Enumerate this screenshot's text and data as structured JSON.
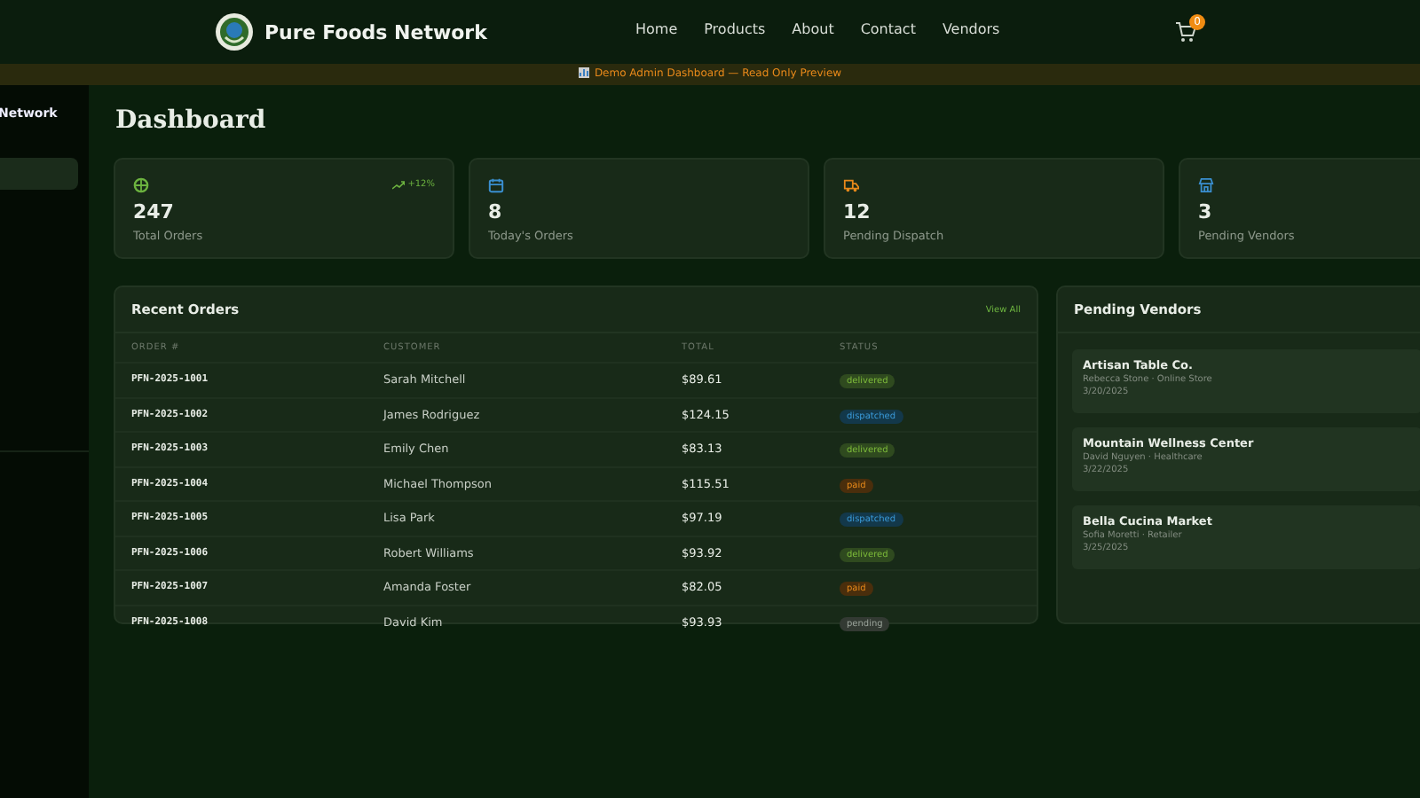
{
  "nav": {
    "brand": "Pure Foods Network",
    "links": [
      "Home",
      "Products",
      "About",
      "Contact",
      "Vendors"
    ],
    "cart_count": "0"
  },
  "banner": {
    "text": "Demo Admin Dashboard — Read Only Preview"
  },
  "sidebar": {
    "brand": "Network",
    "items": [
      {
        "selected": true
      }
    ]
  },
  "page_title": "Dashboard",
  "stats": [
    {
      "kind": "box",
      "value": "247",
      "label": "Total Orders",
      "trend": "+12%"
    },
    {
      "kind": "calendar",
      "value": "8",
      "label": "Today's Orders"
    },
    {
      "kind": "truck",
      "value": "12",
      "label": "Pending Dispatch"
    },
    {
      "kind": "store",
      "value": "3",
      "label": "Pending Vendors"
    }
  ],
  "orders": {
    "title": "Recent Orders",
    "link": "View All",
    "columns": [
      "ORDER #",
      "CUSTOMER",
      "TOTAL",
      "STATUS"
    ],
    "rows": [
      {
        "order": "PFN-2025-1001",
        "customer": "Sarah Mitchell",
        "total": "$89.61",
        "status": {
          "kind": "delivered",
          "text": "delivered"
        }
      },
      {
        "order": "PFN-2025-1002",
        "customer": "James Rodriguez",
        "total": "$124.15",
        "status": {
          "kind": "dispatched",
          "text": "dispatched"
        }
      },
      {
        "order": "PFN-2025-1003",
        "customer": "Emily Chen",
        "total": "$83.13",
        "status": {
          "kind": "delivered",
          "text": "delivered"
        }
      },
      {
        "order": "PFN-2025-1004",
        "customer": "Michael Thompson",
        "total": "$115.51",
        "status": {
          "kind": "paid",
          "text": "paid"
        }
      },
      {
        "order": "PFN-2025-1005",
        "customer": "Lisa Park",
        "total": "$97.19",
        "status": {
          "kind": "dispatched",
          "text": "dispatched"
        }
      },
      {
        "order": "PFN-2025-1006",
        "customer": "Robert Williams",
        "total": "$93.92",
        "status": {
          "kind": "delivered",
          "text": "delivered"
        }
      },
      {
        "order": "PFN-2025-1007",
        "customer": "Amanda Foster",
        "total": "$82.05",
        "status": {
          "kind": "paid",
          "text": "paid"
        }
      },
      {
        "order": "PFN-2025-1008",
        "customer": "David Kim",
        "total": "$93.93",
        "status": {
          "kind": "pending",
          "text": "pending"
        }
      }
    ]
  },
  "vendors": {
    "title": "Pending Vendors",
    "items": [
      {
        "name": "Artisan Table Co.",
        "detail": "Rebecca Stone · Online Store",
        "date": "3/20/2025"
      },
      {
        "name": "Mountain Wellness Center",
        "detail": "David Nguyen · Healthcare",
        "date": "3/22/2025"
      },
      {
        "name": "Bella Cucina Market",
        "detail": "Sofia Moretti · Retailer",
        "date": "3/25/2025"
      }
    ]
  }
}
